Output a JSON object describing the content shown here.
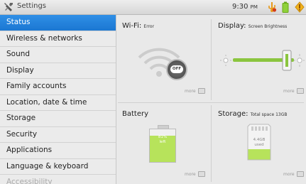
{
  "statusbar": {
    "app_title": "Settings",
    "time": "9:30",
    "ampm": "PM",
    "icons": [
      "settings-app-icon",
      "usb-warning-icon",
      "battery-icon",
      "notification-icon"
    ]
  },
  "sidebar": {
    "items": [
      {
        "label": "Status",
        "active": true
      },
      {
        "label": "Wireless & networks"
      },
      {
        "label": "Sound"
      },
      {
        "label": "Display"
      },
      {
        "label": "Family accounts"
      },
      {
        "label": "Location, date & time"
      },
      {
        "label": "Storage"
      },
      {
        "label": "Security"
      },
      {
        "label": "Applications"
      },
      {
        "label": "Language & keyboard"
      },
      {
        "label": "Accessibility"
      }
    ]
  },
  "wifi": {
    "title": "Wi-Fi:",
    "status": "Error",
    "toggle_label": "OFF",
    "more": "more"
  },
  "display": {
    "title": "Display:",
    "subtitle": "Screen Brightness",
    "more": "more",
    "brightness_level": 0.88
  },
  "battery": {
    "title": "Battery",
    "percent": "81%",
    "caption": "left",
    "level": 0.81,
    "more": "more"
  },
  "storage": {
    "title": "Storage:",
    "subtitle": "Total space 13GB",
    "used_value": "4.4GB",
    "used_caption": "used",
    "used_fraction": 0.34,
    "more": "more"
  },
  "colors": {
    "accent": "#1b77d2",
    "battery_green": "#b7e35b",
    "brightness_green": "#8bc53f"
  }
}
